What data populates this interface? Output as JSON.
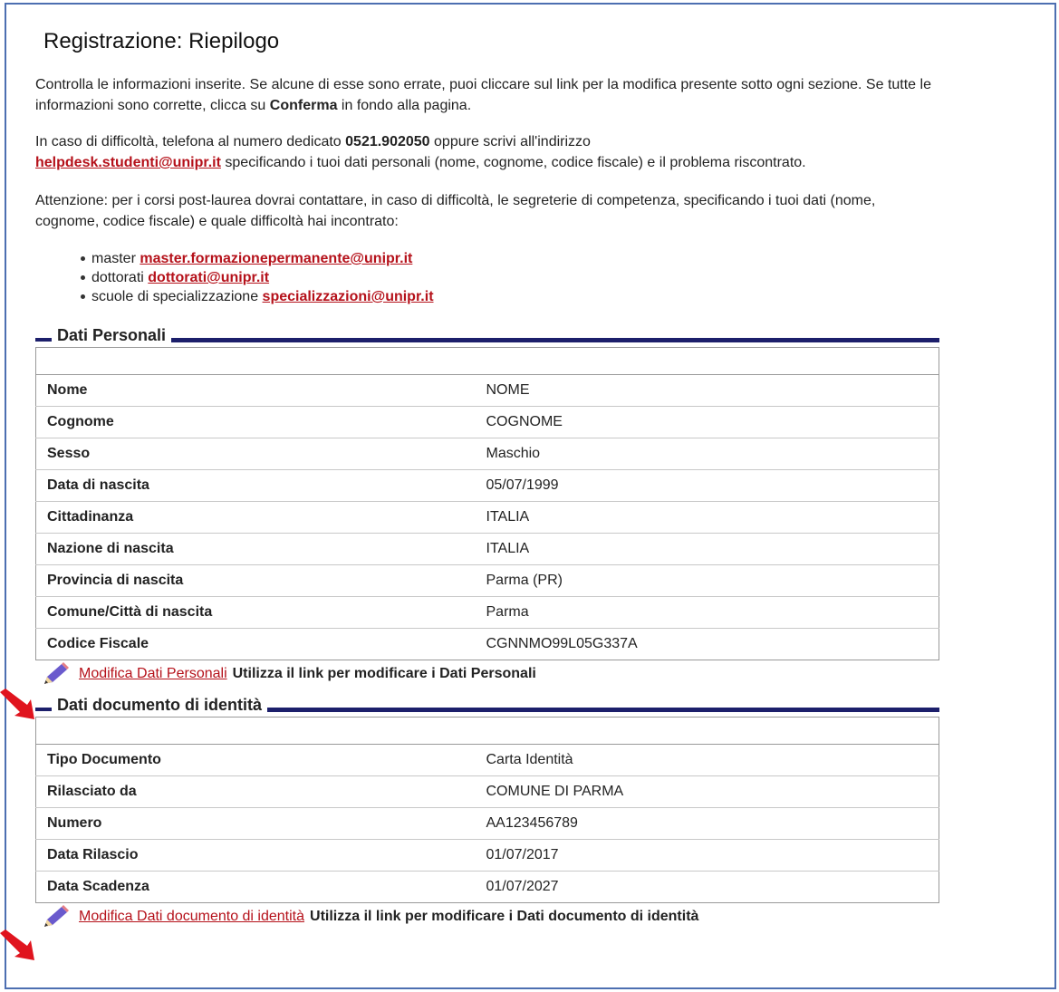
{
  "page": {
    "title": "Registrazione: Riepilogo"
  },
  "intro": {
    "p1_text": "Controlla le informazioni inserite. Se alcune di esse sono errate, puoi cliccare sul link per la modifica presente sotto ogni sezione. Se tutte le informazioni sono corrette, clicca su ",
    "p1_bold": "Conferma",
    "p1_end": " in fondo alla pagina.",
    "p2_text": "In caso di difficoltà, telefona al numero dedicato ",
    "p2_phone": "0521.902050",
    "p2_mid": " oppure scrivi all'indirizzo",
    "p2_email": "helpdesk.studenti@unipr.it",
    "p2_end": " specificando i tuoi dati personali (nome, cognome, codice fiscale) e il problema riscontrato.",
    "p3_text": "Attenzione: per i corsi post-laurea dovrai contattare, in caso di difficoltà, le segreterie di competenza, specificando i tuoi dati (nome, cognome, codice fiscale) e quale difficoltà hai incontrato:"
  },
  "contacts": [
    {
      "label": "master ",
      "email": "master.formazionepermanente@unipr.it"
    },
    {
      "label": "dottorati ",
      "email": "dottorati@unipr.it"
    },
    {
      "label": "scuole di specializzazione ",
      "email": "specializzazioni@unipr.it"
    }
  ],
  "personal": {
    "title": "Dati Personali",
    "rows": [
      {
        "k": "Nome",
        "v": "NOME"
      },
      {
        "k": "Cognome",
        "v": "COGNOME"
      },
      {
        "k": "Sesso",
        "v": "Maschio"
      },
      {
        "k": "Data di nascita",
        "v": "05/07/1999"
      },
      {
        "k": "Cittadinanza",
        "v": "ITALIA"
      },
      {
        "k": "Nazione di nascita",
        "v": "ITALIA"
      },
      {
        "k": "Provincia di nascita",
        "v": "Parma (PR)"
      },
      {
        "k": "Comune/Città di nascita",
        "v": "Parma"
      },
      {
        "k": "Codice Fiscale",
        "v": "CGNNMO99L05G337A"
      }
    ],
    "edit_link": "Modifica Dati Personali ",
    "edit_hint": "Utilizza il link per modificare i Dati Personali"
  },
  "document": {
    "title": "Dati documento di identità",
    "rows": [
      {
        "k": "Tipo Documento",
        "v": "Carta Identità"
      },
      {
        "k": "Rilasciato da",
        "v": "COMUNE DI PARMA"
      },
      {
        "k": "Numero",
        "v": "AA123456789"
      },
      {
        "k": "Data Rilascio",
        "v": "01/07/2017"
      },
      {
        "k": "Data Scadenza",
        "v": "01/07/2027"
      }
    ],
    "edit_link": "Modifica Dati documento di identità",
    "edit_hint": "Utilizza il link per modificare i Dati documento di identità"
  },
  "colors": {
    "link": "#b5111a",
    "section_bar": "#1c1f6b",
    "frame": "#4d6fb1",
    "arrow": "#e0141e"
  },
  "icons": [
    "pencil-icon",
    "red-arrow-icon"
  ]
}
